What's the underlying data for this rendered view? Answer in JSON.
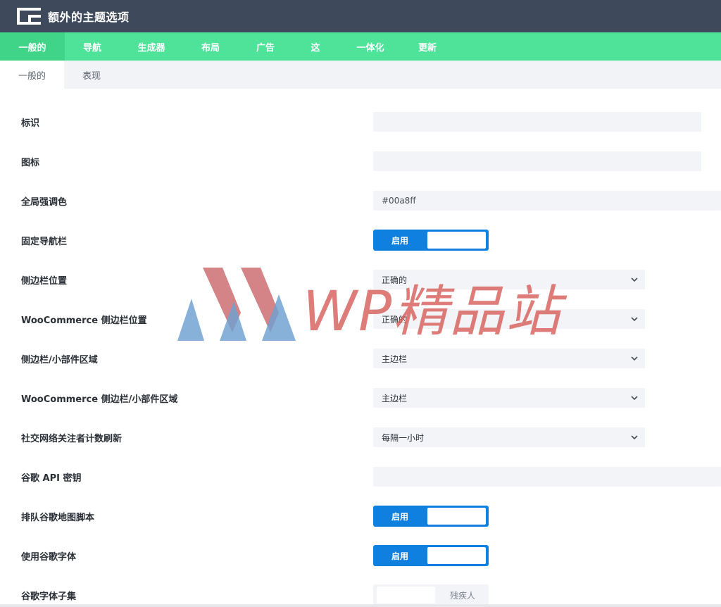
{
  "app": {
    "title": "额外的主题选项"
  },
  "main_tabs": [
    {
      "label": "一般的",
      "active": true
    },
    {
      "label": "导航"
    },
    {
      "label": "生成器"
    },
    {
      "label": "布局"
    },
    {
      "label": "广告"
    },
    {
      "label": "这"
    },
    {
      "label": "一体化"
    },
    {
      "label": "更新"
    }
  ],
  "sub_tabs": [
    {
      "label": "一般的",
      "active": true
    },
    {
      "label": "表现"
    }
  ],
  "settings": {
    "logo": {
      "label": "标识",
      "value": ""
    },
    "icon": {
      "label": "图标",
      "value": ""
    },
    "accent_color": {
      "label": "全局强调色",
      "value": "#00a8ff"
    },
    "fixed_nav": {
      "label": "固定导航栏",
      "toggle_label": "启用",
      "enabled": true
    },
    "sidebar_position": {
      "label": "侧边栏位置",
      "selected": "正确的"
    },
    "woo_sidebar_position": {
      "label": "WooCommerce 侧边栏位置",
      "selected": "正确的"
    },
    "sidebar_widget_area": {
      "label": "侧边栏/小部件区域",
      "selected": "主边栏"
    },
    "woo_sidebar_widget_area": {
      "label": "WooCommerce 侧边栏/小部件区域",
      "selected": "主边栏"
    },
    "social_refresh": {
      "label": "社交网络关注者计数刷新",
      "selected": "每隔一小时"
    },
    "google_api_key": {
      "label": "谷歌 API 密钥",
      "value": ""
    },
    "enqueue_google_maps": {
      "label": "排队谷歌地图脚本",
      "toggle_label": "启用",
      "enabled": true
    },
    "use_google_fonts": {
      "label": "使用谷歌字体",
      "toggle_label": "启用",
      "enabled": true
    },
    "google_font_subsets": {
      "label": "谷歌字体子集",
      "toggle_label": "残疾人",
      "enabled": false
    }
  },
  "watermark": {
    "text": "WP精品站"
  },
  "colors": {
    "topbar": "#3e4a5c",
    "main_nav": "#4fe39a",
    "toggle_on": "#0f7fe0",
    "field_bg": "#f3f4f7"
  }
}
